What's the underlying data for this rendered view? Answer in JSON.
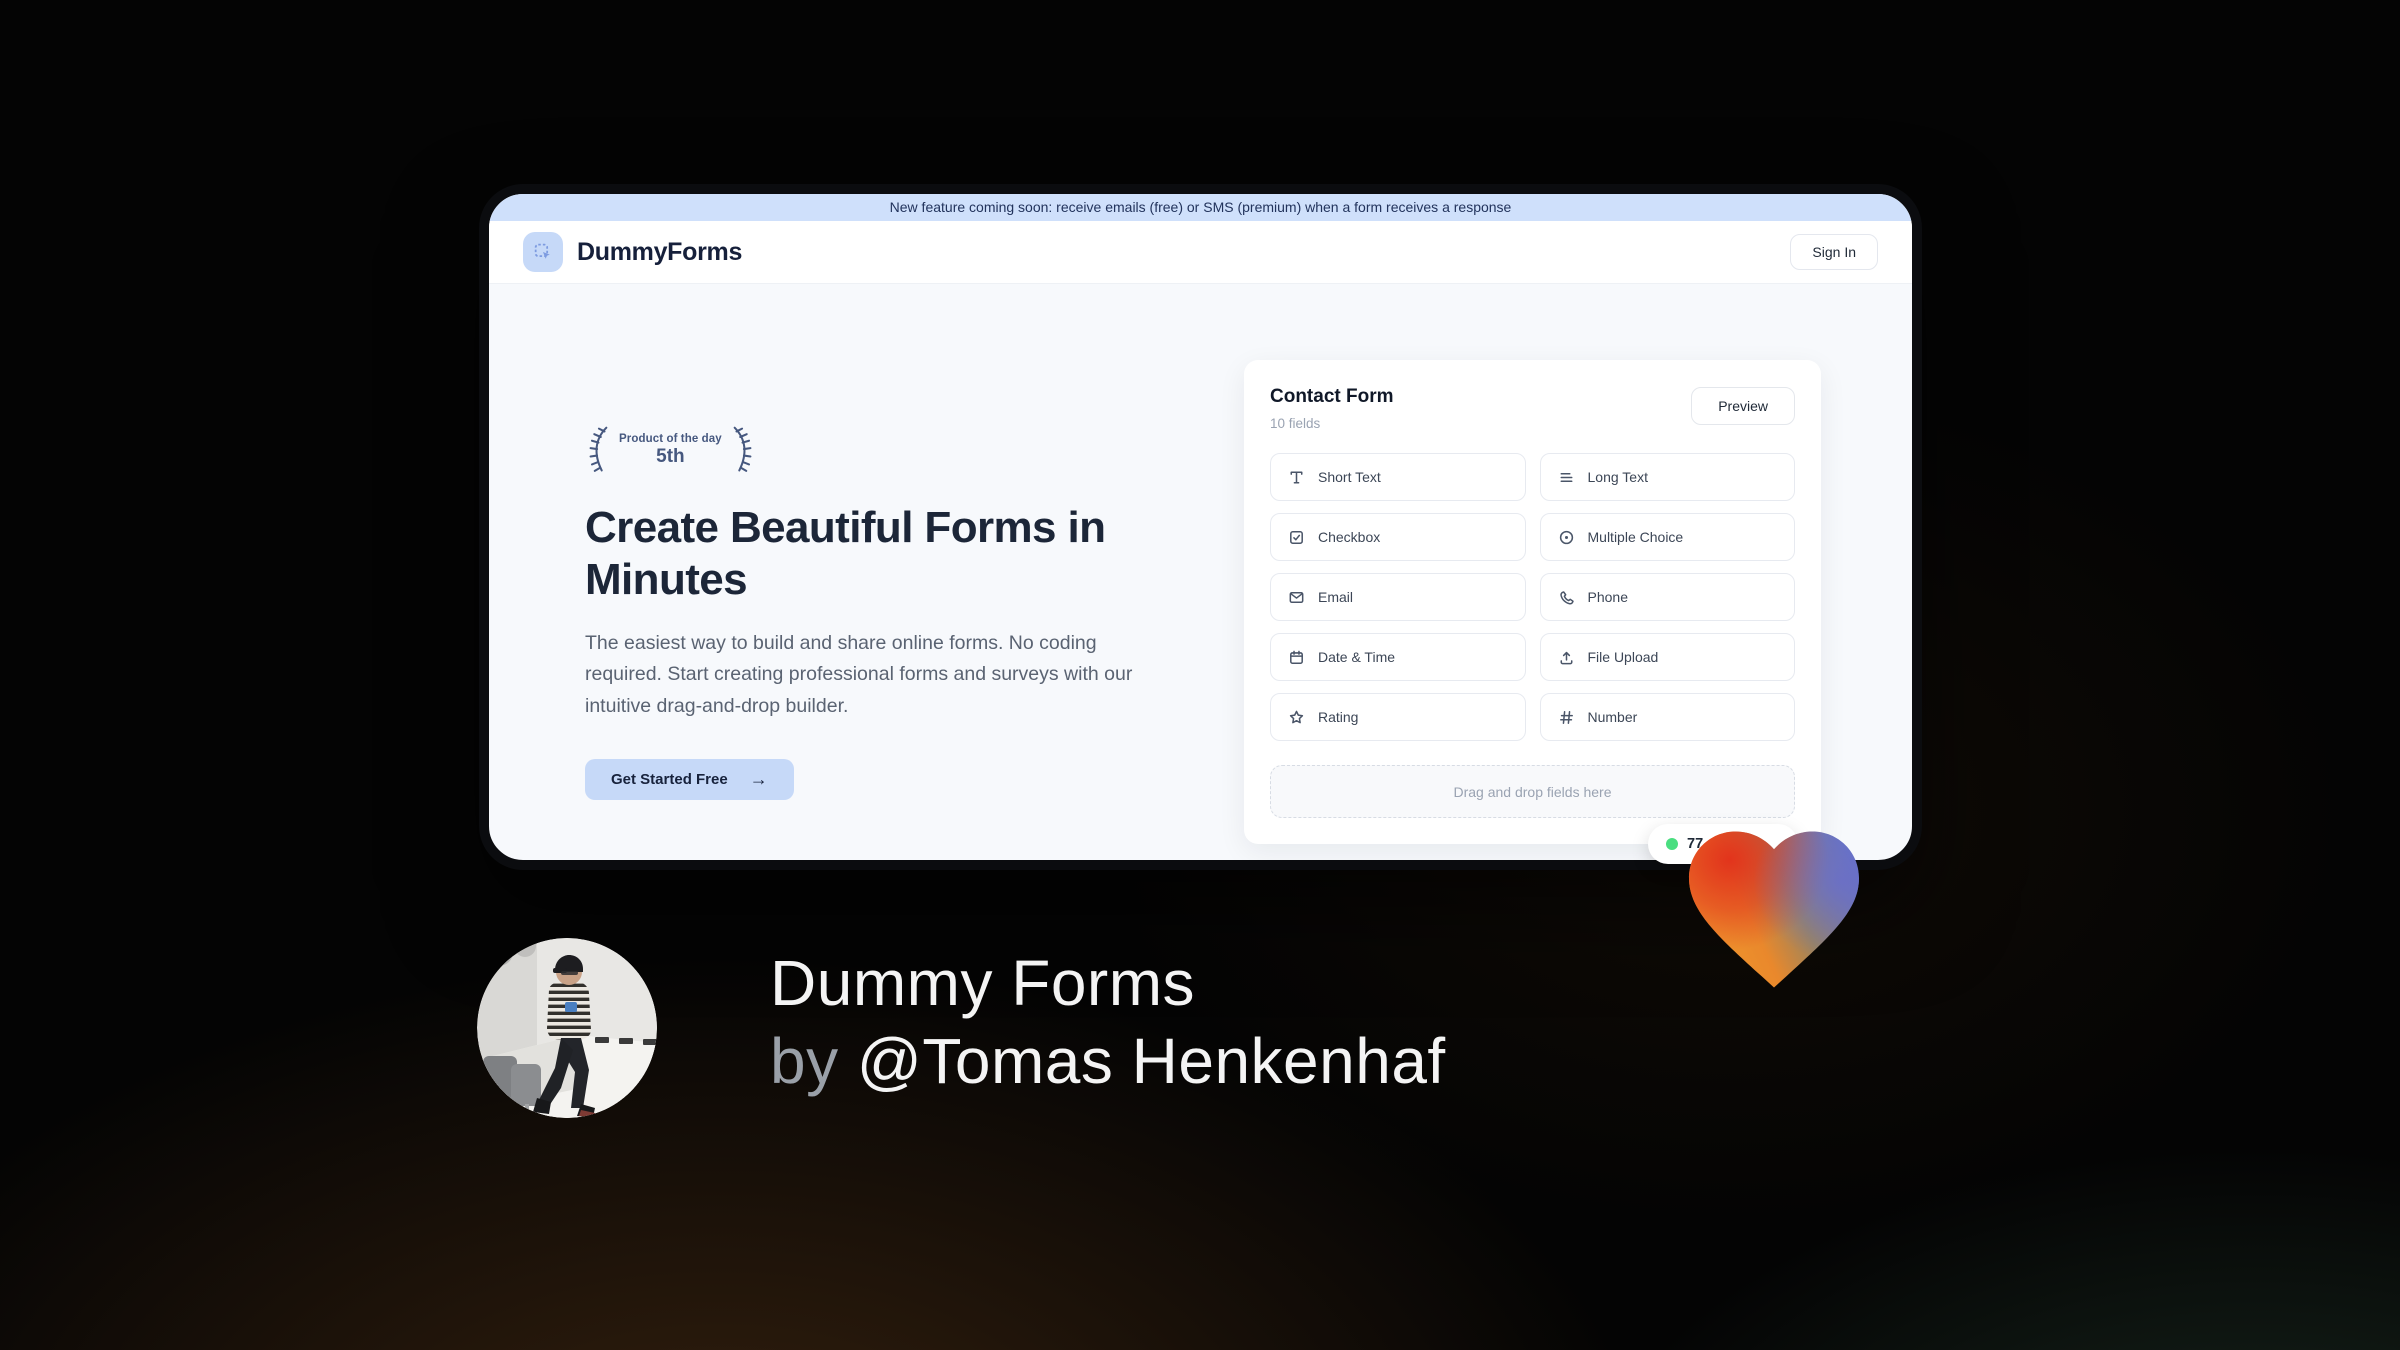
{
  "window": {
    "banner": {
      "text": "New feature coming soon: receive emails (free) or SMS (premium) when a form receives a response"
    },
    "header": {
      "brand": "DummyForms",
      "sign_in_label": "Sign In"
    },
    "hero": {
      "award": {
        "top": "Product of the day",
        "rank": "5th"
      },
      "title": "Create Beautiful Forms in Minutes",
      "description": "The easiest way to build and share online forms. No coding required. Start creating professional forms and surveys with our intuitive drag-and-drop builder.",
      "cta_label": "Get Started Free",
      "cta_arrow": "→"
    },
    "form_card": {
      "title": "Contact Form",
      "subtitle": "10 fields",
      "preview_label": "Preview",
      "fields": [
        {
          "label": "Short Text",
          "icon": "short-text-icon"
        },
        {
          "label": "Long Text",
          "icon": "long-text-icon"
        },
        {
          "label": "Checkbox",
          "icon": "checkbox-icon"
        },
        {
          "label": "Multiple Choice",
          "icon": "multiple-choice-icon"
        },
        {
          "label": "Email",
          "icon": "email-icon"
        },
        {
          "label": "Phone",
          "icon": "phone-icon"
        },
        {
          "label": "Date & Time",
          "icon": "calendar-icon"
        },
        {
          "label": "File Upload",
          "icon": "upload-icon"
        },
        {
          "label": "Rating",
          "icon": "star-icon"
        },
        {
          "label": "Number",
          "icon": "hash-icon"
        }
      ],
      "dropzone_text": "Drag and drop fields here"
    }
  },
  "status_badge": {
    "text": "77",
    "dot_color": "#4ade80"
  },
  "footer": {
    "product_name": "Dummy Forms",
    "byline_prefix": "by ",
    "author_handle": "@Tomas Henkenhaf"
  },
  "colors": {
    "banner_blue": "#cfe0fb",
    "accent_blue": "#c6d9f8",
    "navy": "#16203b",
    "laurel": "#46587f",
    "heart_red": "#e2341c",
    "heart_orange": "#f29a2d",
    "heart_purple": "#6a6fc9",
    "status_green": "#4ade80"
  }
}
